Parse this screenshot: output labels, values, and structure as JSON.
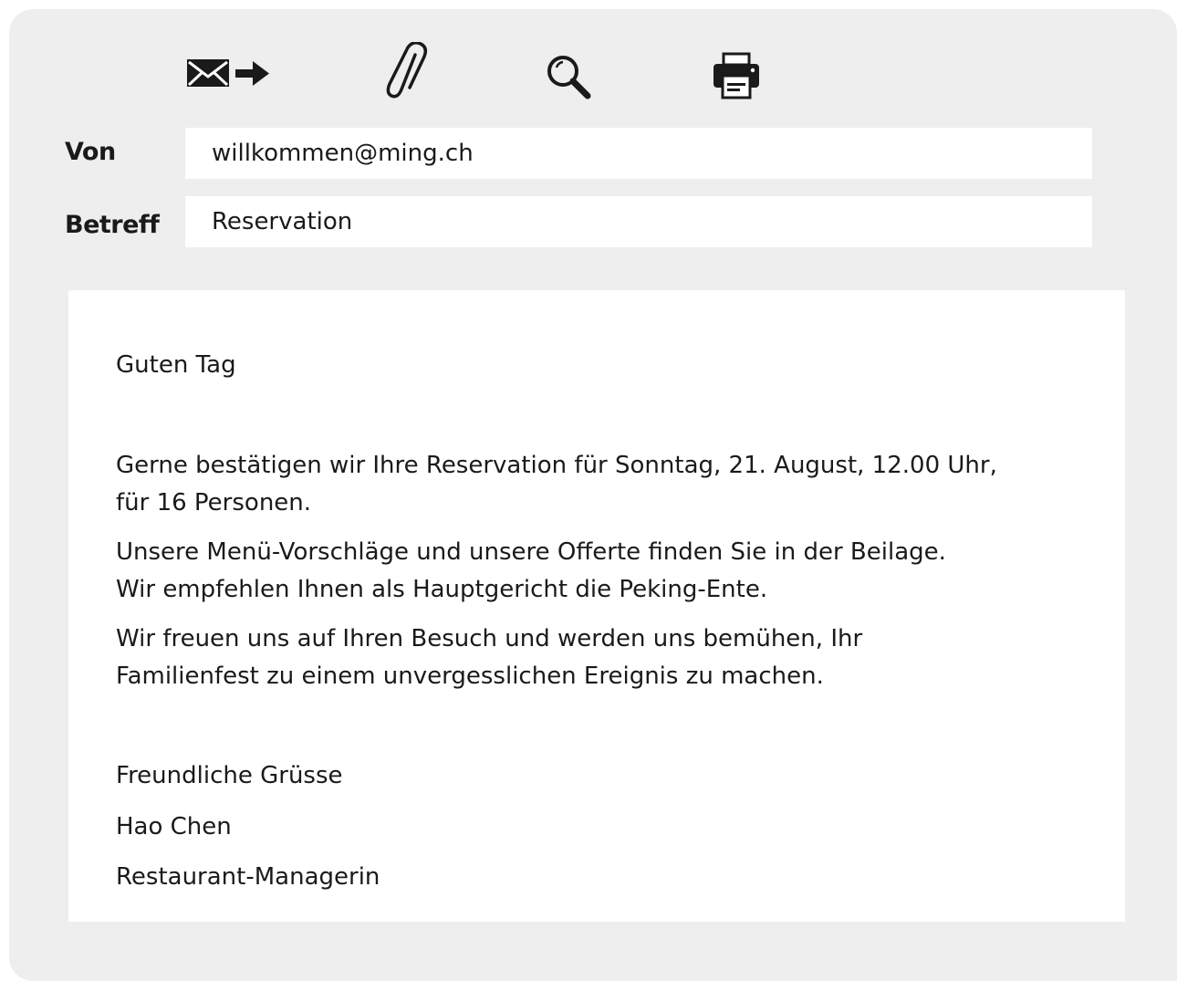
{
  "toolbar": {
    "icons": [
      "send-mail-icon",
      "paperclip-icon",
      "search-icon",
      "printer-icon"
    ]
  },
  "header": {
    "from_label": "Von",
    "from_value": "willkommen@ming.ch",
    "subject_label": "Betreff",
    "subject_value": "Reservation"
  },
  "message": {
    "greeting": "Guten Tag",
    "para1_line1": "Gerne bestätigen wir Ihre Reservation für Sonntag, 21. August, 12.00 Uhr,",
    "para1_line2": "für 16 Personen.",
    "para2_line1": "Unsere Menü-Vorschläge und unsere Offerte finden Sie in der Beilage.",
    "para2_line2": "Wir empfehlen Ihnen als Hauptgericht die Peking-Ente.",
    "para3_line1": "Wir freuen uns auf Ihren Besuch und werden uns bemühen, Ihr",
    "para3_line2": "Familienfest zu einem unvergesslichen Ereignis zu machen.",
    "closing": "Freundliche Grüsse",
    "signature_name": "Hao Chen",
    "signature_role": "Restaurant-Managerin"
  },
  "colors": {
    "window_background": "#eeeeee",
    "field_background": "#ffffff",
    "text": "#1a1a1a"
  }
}
